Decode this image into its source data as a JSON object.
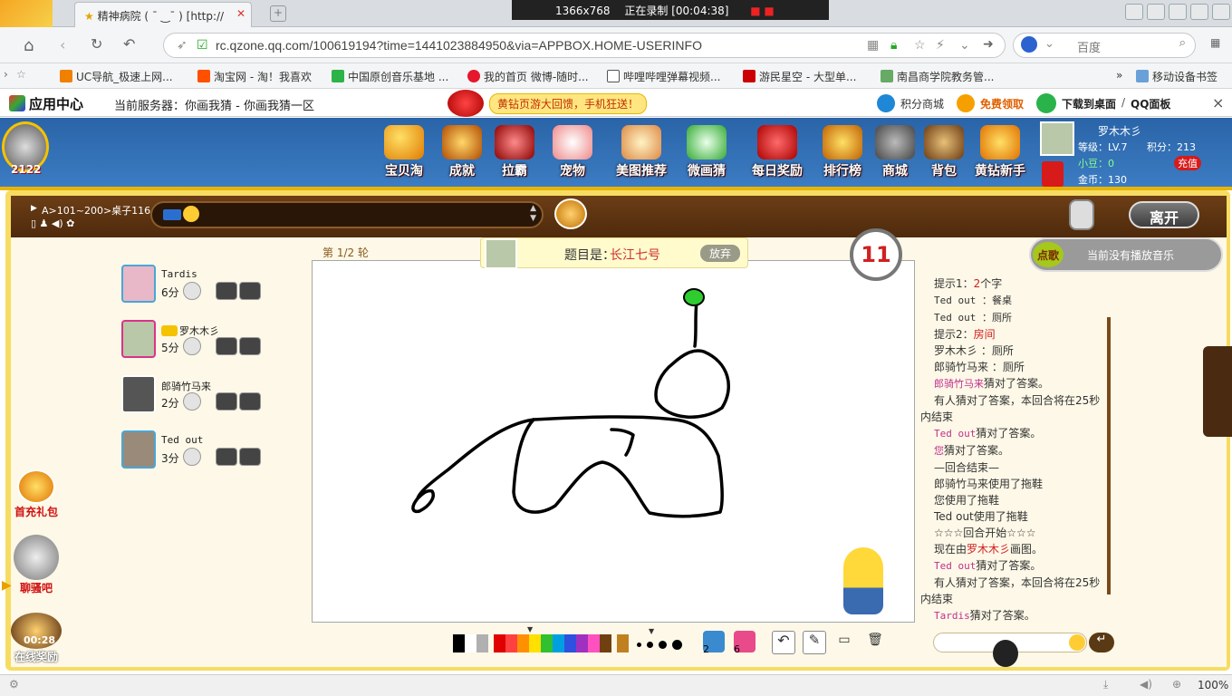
{
  "browser": {
    "tab_title": "精神病院 ( ¯ ‿¯ ) [http://",
    "recording": {
      "resolution": "1366x768",
      "status": "正在录制 [00:04:38]"
    },
    "url": "rc.qzone.qq.com/100619194?time=1441023884950&via=APPBOX.HOME-USERINFO",
    "search_engine": "百度",
    "bookmarks": [
      "UC导航_极速上网...",
      "淘宝网 - 淘！我喜欢",
      "中国原创音乐基地 ...",
      "我的首页 微博-随时...",
      "哔哩哔哩弹幕视频...",
      "游民星空 - 大型单...",
      "南昌商学院教务管..."
    ],
    "bookmark_more": "»",
    "mobile_bookmarks": "移动设备书签",
    "zoom": "100%"
  },
  "app_header": {
    "title": "应用中心",
    "server": "当前服务器：你画我猜 - 你画我猜一区",
    "promo": "黄钻页游大回馈，手机狂送！",
    "points_mall": "积分商城",
    "free_claim": "免费领取",
    "download": "下载到桌面",
    "qq_panel": "QQ面板",
    "close": "×"
  },
  "game_nav": {
    "level_badge": "2122",
    "items": [
      "宝贝淘",
      "成就",
      "拉霸",
      "宠物",
      "美图推荐",
      "微画猜",
      "每日奖励",
      "排行榜",
      "商城",
      "背包",
      "黄钻新手"
    ],
    "user": {
      "name": "罗木木彡",
      "level": "等级：LV.7",
      "points": "积分：213",
      "small_change": "小豆：0",
      "coins": "金币：130",
      "recharge": "充值"
    }
  },
  "toolbar": {
    "room": "A>101~200>桌子116",
    "leave": "离开"
  },
  "round": "第 1/2 轮",
  "topic": {
    "label": "题目是：",
    "answer": "长江七号",
    "giveup": "放弃"
  },
  "timer": "11",
  "music": {
    "sing": "点歌",
    "status": "当前没有播放音乐"
  },
  "players": [
    {
      "name": "Tardis",
      "score": "6分",
      "color": "#4aa6d6"
    },
    {
      "name": "罗木木彡",
      "score": "5分",
      "color": "#d9338a"
    },
    {
      "name": "郎骑竹马来",
      "score": "2分",
      "color": "#4aa6d6"
    },
    {
      "name": "Ted out",
      "score": "3分",
      "color": "#4aa6d6"
    }
  ],
  "chat": [
    {
      "text": "提示1：",
      "extra": "2",
      "tail": "个字",
      "cls": "sys"
    },
    {
      "text": "Ted out ：餐桌",
      "cls": "mono"
    },
    {
      "text": "Ted out ：厕所",
      "cls": "mono"
    },
    {
      "text": "提示2：",
      "extra": "房间",
      "cls": "sys"
    },
    {
      "text": "罗木木彡 ：厕所",
      "cls": "sys"
    },
    {
      "text": "郎骑竹马来 ：厕所",
      "cls": "sys"
    },
    {
      "text": "郎骑竹马来",
      "tail": "猜对了答案。",
      "cls": "nm"
    },
    {
      "text": "有人猜对了答案，本回合将在25秒",
      "cls": "sys"
    },
    {
      "text": "内结束",
      "cls": "sys"
    },
    {
      "text": "Ted out",
      "tail": "猜对了答案。",
      "cls": "nm"
    },
    {
      "text": "您",
      "tail": "猜对了答案。",
      "cls": "nm"
    },
    {
      "text": "—回合结束—",
      "cls": "sys"
    },
    {
      "text": "郎骑竹马来使用了拖鞋",
      "cls": "sys"
    },
    {
      "text": "您使用了拖鞋",
      "cls": "sys"
    },
    {
      "text": "Ted out使用了拖鞋",
      "cls": "sys"
    },
    {
      "text": "☆☆☆回合开始☆☆☆",
      "cls": "sys"
    },
    {
      "text": "现在由",
      "extra": "罗木木彡",
      "tail": "画图。",
      "cls": "sys"
    },
    {
      "text": "Ted out",
      "tail": "猜对了答案。",
      "cls": "nm"
    },
    {
      "text": "有人猜对了答案，本回合将在25秒",
      "cls": "sys"
    },
    {
      "text": "内结束",
      "cls": "sys"
    },
    {
      "text": "Tardis",
      "tail": "猜对了答案。",
      "cls": "nm"
    }
  ],
  "palette": [
    "#000000",
    "#ffffff",
    "#b0b0b0",
    "#e00000",
    "#ff4040",
    "#ff9000",
    "#ffe000",
    "#30c030",
    "#00a0e0",
    "#3050e0",
    "#a030c0",
    "#ff50c0",
    "#704010",
    "#c08020"
  ],
  "tools": {
    "hourglass_count": "2",
    "swap_count": "6"
  },
  "side": {
    "first_recharge": "首充礼包",
    "bar": "聊骚吧",
    "online_reward_time": "00:28",
    "online_reward": "在线奖励"
  }
}
